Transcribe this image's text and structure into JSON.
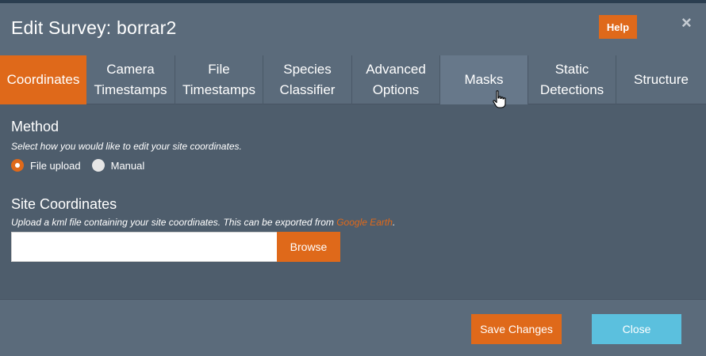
{
  "modal": {
    "title": "Edit Survey: borrar2",
    "help_label": "Help",
    "close_symbol": "×"
  },
  "tabs": [
    {
      "line1": "Coordinates",
      "line2": "",
      "active": true
    },
    {
      "line1": "Camera",
      "line2": "Timestamps"
    },
    {
      "line1": "File",
      "line2": "Timestamps"
    },
    {
      "line1": "Species",
      "line2": "Classifier"
    },
    {
      "line1": "Advanced",
      "line2": "Options"
    },
    {
      "line1": "Masks",
      "line2": "",
      "hover": true
    },
    {
      "line1": "Static",
      "line2": "Detections"
    },
    {
      "line1": "Structure",
      "line2": ""
    }
  ],
  "method": {
    "title": "Method",
    "help": "Select how you would like to edit your site coordinates.",
    "options": [
      {
        "label": "File upload",
        "checked": true
      },
      {
        "label": "Manual",
        "checked": false
      }
    ]
  },
  "site_coordinates": {
    "title": "Site Coordinates",
    "help_prefix": "Upload a kml file containing your site coordinates. This can be exported from ",
    "help_link": "Google Earth",
    "help_suffix": ".",
    "file_value": "",
    "browse_label": "Browse"
  },
  "footer": {
    "save_label": "Save Changes",
    "close_label": "Close"
  },
  "colors": {
    "accent": "#df691a",
    "info": "#5bc0de",
    "panel": "#4e5d6c",
    "header": "#5b6b7b"
  },
  "icons": {
    "cursor": "hand-pointer-icon",
    "close": "close-icon"
  }
}
